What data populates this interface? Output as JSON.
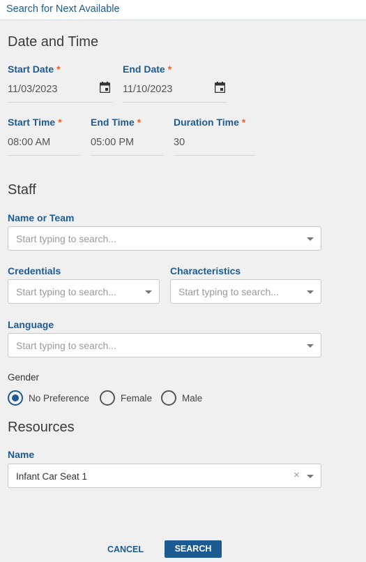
{
  "header": {
    "title": "Search for Next Available"
  },
  "date_time": {
    "section_title": "Date and Time",
    "start_date": {
      "label": "Start Date",
      "required_mark": "*",
      "value": "11/03/2023",
      "icon": "calendar-icon"
    },
    "end_date": {
      "label": "End Date",
      "required_mark": "*",
      "value": "11/10/2023",
      "icon": "calendar-icon"
    },
    "start_time": {
      "label": "Start Time",
      "required_mark": "*",
      "value": "08:00 AM"
    },
    "end_time": {
      "label": "End Time",
      "required_mark": "*",
      "value": "05:00 PM"
    },
    "duration_time": {
      "label": "Duration Time",
      "required_mark": "*",
      "value": "30"
    }
  },
  "staff": {
    "section_title": "Staff",
    "name_or_team": {
      "label": "Name or Team",
      "placeholder": "Start typing to search..."
    },
    "credentials": {
      "label": "Credentials",
      "placeholder": "Start typing to search..."
    },
    "characteristics": {
      "label": "Characteristics",
      "placeholder": "Start typing to search..."
    },
    "language": {
      "label": "Language",
      "placeholder": "Start typing to search..."
    },
    "gender": {
      "label": "Gender",
      "options": [
        {
          "label": "No Preference",
          "selected": true
        },
        {
          "label": "Female",
          "selected": false
        },
        {
          "label": "Male",
          "selected": false
        }
      ]
    }
  },
  "resources": {
    "section_title": "Resources",
    "name": {
      "label": "Name",
      "value": "Infant Car Seat 1",
      "clear_glyph": "×"
    }
  },
  "actions": {
    "cancel_label": "CANCEL",
    "search_label": "SEARCH"
  },
  "colors": {
    "accent": "#1c5b92",
    "required": "#e8632a",
    "background": "#f0f0f1"
  }
}
